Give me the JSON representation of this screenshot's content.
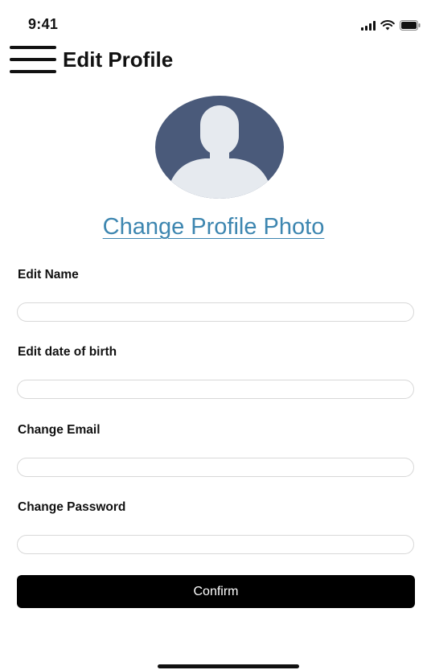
{
  "status_bar": {
    "time": "9:41",
    "icons": [
      "signal-icon",
      "wifi-icon",
      "battery-icon"
    ]
  },
  "header": {
    "title": "Edit Profile",
    "menu_icon": "menu-icon"
  },
  "profile": {
    "avatar_icon": "avatar-placeholder-icon",
    "avatar_color": "#4a5a7a",
    "change_photo_label": "Change Profile Photo",
    "link_color": "#3d86b0"
  },
  "form": {
    "fields": [
      {
        "label": "Edit Name",
        "value": "",
        "placeholder": ""
      },
      {
        "label": "Edit date of birth",
        "value": "",
        "placeholder": ""
      },
      {
        "label": "Change Email",
        "value": "",
        "placeholder": ""
      },
      {
        "label": "Change Password",
        "value": "",
        "placeholder": ""
      }
    ],
    "confirm_label": "Confirm"
  }
}
